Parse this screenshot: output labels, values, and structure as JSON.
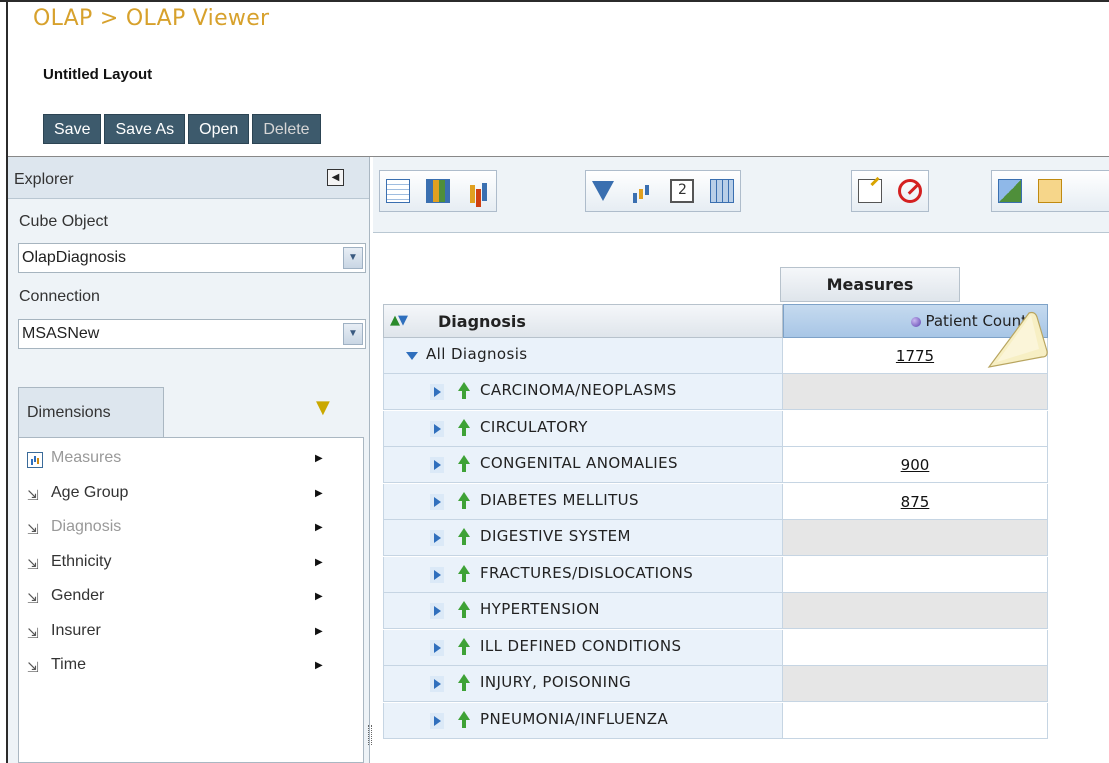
{
  "header": {
    "breadcrumb": "OLAP > OLAP Viewer",
    "layout_title": "Untitled Layout"
  },
  "actions": {
    "save": "Save",
    "save_as": "Save As",
    "open": "Open",
    "delete": "Delete"
  },
  "explorer": {
    "title": "Explorer",
    "cube_object_label": "Cube Object",
    "cube_object_value": "OlapDiagnosis",
    "connection_label": "Connection",
    "connection_value": "MSASNew",
    "dimensions_tab": "Dimensions",
    "dimensions": [
      {
        "label": "Measures",
        "icon": "measures-icon",
        "greyed": true
      },
      {
        "label": "Age Group",
        "icon": "hierarchy-icon",
        "greyed": false
      },
      {
        "label": "Diagnosis",
        "icon": "hierarchy-icon",
        "greyed": true
      },
      {
        "label": "Ethnicity",
        "icon": "hierarchy-icon",
        "greyed": false
      },
      {
        "label": "Gender",
        "icon": "hierarchy-icon",
        "greyed": false
      },
      {
        "label": "Insurer",
        "icon": "hierarchy-icon",
        "greyed": false
      },
      {
        "label": "Time",
        "icon": "hierarchy-icon",
        "greyed": false
      }
    ]
  },
  "grid": {
    "measures_header": "Measures",
    "row_header": "Diagnosis",
    "column_header": "Patient Count",
    "all_label": "All Diagnosis",
    "all_value": "1775",
    "rows": [
      {
        "label": "CARCINOMA/NEOPLASMS",
        "value": "",
        "shaded": true
      },
      {
        "label": "CIRCULATORY",
        "value": "",
        "shaded": false
      },
      {
        "label": "CONGENITAL ANOMALIES",
        "value": "900",
        "shaded": false
      },
      {
        "label": "DIABETES MELLITUS",
        "value": "875",
        "shaded": false
      },
      {
        "label": "DIGESTIVE SYSTEM",
        "value": "",
        "shaded": true
      },
      {
        "label": "FRACTURES/DISLOCATIONS",
        "value": "",
        "shaded": false
      },
      {
        "label": "HYPERTENSION",
        "value": "",
        "shaded": true
      },
      {
        "label": "ILL DEFINED CONDITIONS",
        "value": "",
        "shaded": false
      },
      {
        "label": "INJURY, POISONING",
        "value": "",
        "shaded": true
      },
      {
        "label": "PNEUMONIA/INFLUENZA",
        "value": "",
        "shaded": false
      }
    ]
  },
  "colors": {
    "breadcrumb": "#d7a12c",
    "button_bg": "#3d5a6c",
    "header_highlight": "#a8c6e6"
  }
}
